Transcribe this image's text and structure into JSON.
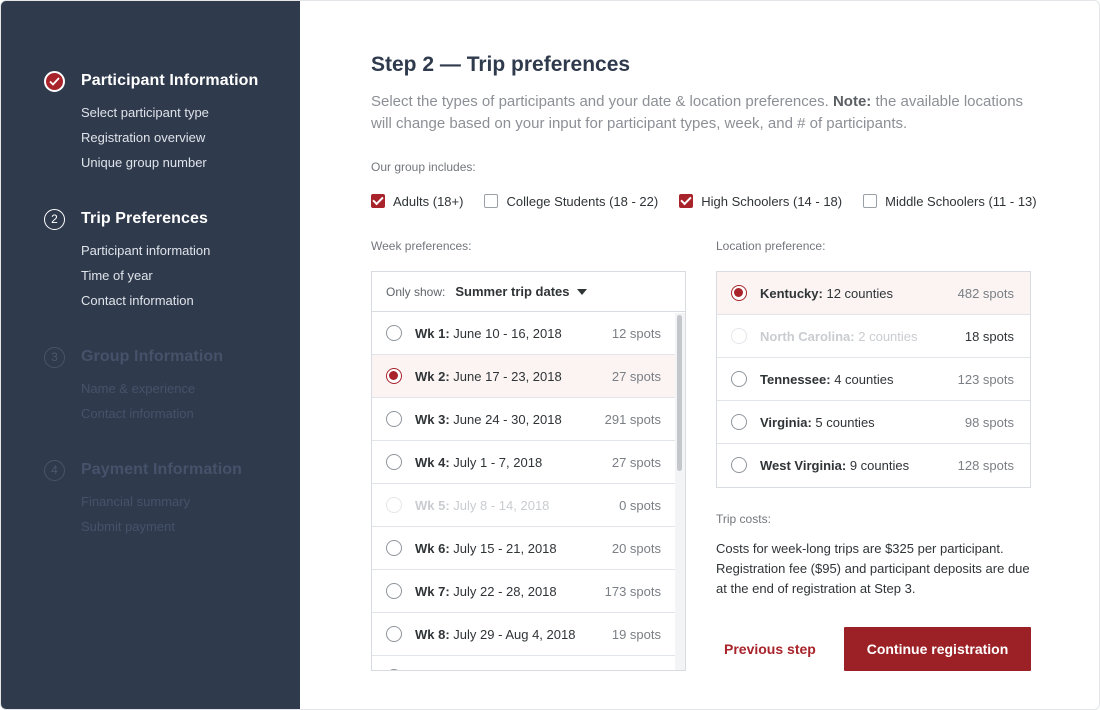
{
  "sidebar": {
    "steps": [
      {
        "number": "",
        "status": "complete",
        "title": "Participant Information",
        "substeps": [
          "Select participant type",
          "Registration overview",
          "Unique group number"
        ]
      },
      {
        "number": "2",
        "status": "active",
        "title": "Trip Preferences",
        "substeps": [
          "Participant information",
          "Time of year",
          "Contact information"
        ]
      },
      {
        "number": "3",
        "status": "upcoming",
        "title": "Group Information",
        "substeps": [
          "Name & experience",
          "Contact information"
        ]
      },
      {
        "number": "4",
        "status": "upcoming",
        "title": "Payment Information",
        "substeps": [
          "Financial summary",
          "Submit payment"
        ]
      }
    ]
  },
  "main": {
    "title": "Step 2 — Trip preferences",
    "intro": "Select the types of participants and your date & location preferences.",
    "note_label": "Note:",
    "note_text": "the available locations will change based on your input for participant types, week, and # of participants.",
    "group_label": "Our group includes:",
    "participant_types": [
      {
        "label": "Adults (18+)",
        "checked": true
      },
      {
        "label": "College Students (18 - 22)",
        "checked": false
      },
      {
        "label": "High Schoolers (14 - 18)",
        "checked": true
      },
      {
        "label": "Middle Schoolers (11 - 13)",
        "checked": false
      }
    ],
    "week_label": "Week preferences:",
    "week_filter_label": "Only show:",
    "week_filter_value": "Summer trip dates",
    "weeks": [
      {
        "name": "Wk 1:",
        "dates": "June 10 - 16, 2018",
        "spots": "12 spots",
        "selected": false,
        "disabled": false
      },
      {
        "name": "Wk 2:",
        "dates": "June 17 - 23, 2018",
        "spots": "27 spots",
        "selected": true,
        "disabled": false
      },
      {
        "name": "Wk 3:",
        "dates": "June 24 - 30, 2018",
        "spots": "291 spots",
        "selected": false,
        "disabled": false
      },
      {
        "name": "Wk 4:",
        "dates": "July 1 - 7, 2018",
        "spots": "27 spots",
        "selected": false,
        "disabled": false
      },
      {
        "name": "Wk 5:",
        "dates": "July 8 - 14, 2018",
        "spots": "0 spots",
        "selected": false,
        "disabled": true
      },
      {
        "name": "Wk 6:",
        "dates": "July 15 - 21, 2018",
        "spots": "20 spots",
        "selected": false,
        "disabled": false
      },
      {
        "name": "Wk 7:",
        "dates": "July 22 - 28, 2018",
        "spots": "173 spots",
        "selected": false,
        "disabled": false
      },
      {
        "name": "Wk 8:",
        "dates": "July 29 - Aug 4, 2018",
        "spots": "19 spots",
        "selected": false,
        "disabled": false
      }
    ],
    "location_label": "Location preference:",
    "locations": [
      {
        "name": "Kentucky:",
        "counties": "12 counties",
        "spots": "482 spots",
        "selected": true,
        "disabled": false
      },
      {
        "name": "North Carolina:",
        "counties": "2 counties",
        "spots": "18 spots",
        "selected": false,
        "disabled": true
      },
      {
        "name": "Tennessee:",
        "counties": "4 counties",
        "spots": "123 spots",
        "selected": false,
        "disabled": false
      },
      {
        "name": "Virginia:",
        "counties": "5 counties",
        "spots": "98 spots",
        "selected": false,
        "disabled": false
      },
      {
        "name": "West Virginia:",
        "counties": "9 counties",
        "spots": "128 spots",
        "selected": false,
        "disabled": false
      }
    ],
    "costs_label": "Trip costs:",
    "costs_text": "Costs for week-long trips are $325 per participant. Registration fee ($95) and participant deposits are due at the end of registration at Step 3.",
    "previous_label": "Previous step",
    "continue_label": "Continue registration"
  },
  "colors": {
    "sidebar_bg": "#2f3a4c",
    "accent": "#a8232a"
  }
}
